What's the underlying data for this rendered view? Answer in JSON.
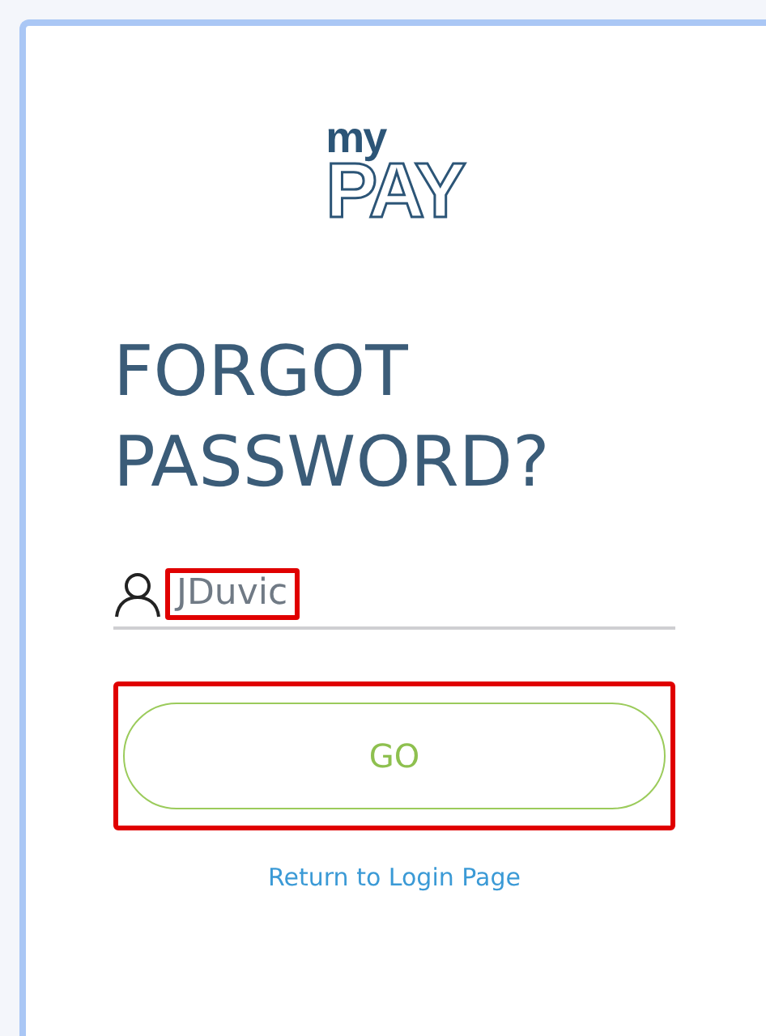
{
  "logo": {
    "line_1": "my",
    "line_2": "PAY"
  },
  "heading": "FORGOT PASSWORD?",
  "username_field": {
    "value": "JDuvic",
    "highlighted": true
  },
  "go_button": {
    "label": "GO",
    "highlighted": true
  },
  "return_link": "Return to Login Page"
}
